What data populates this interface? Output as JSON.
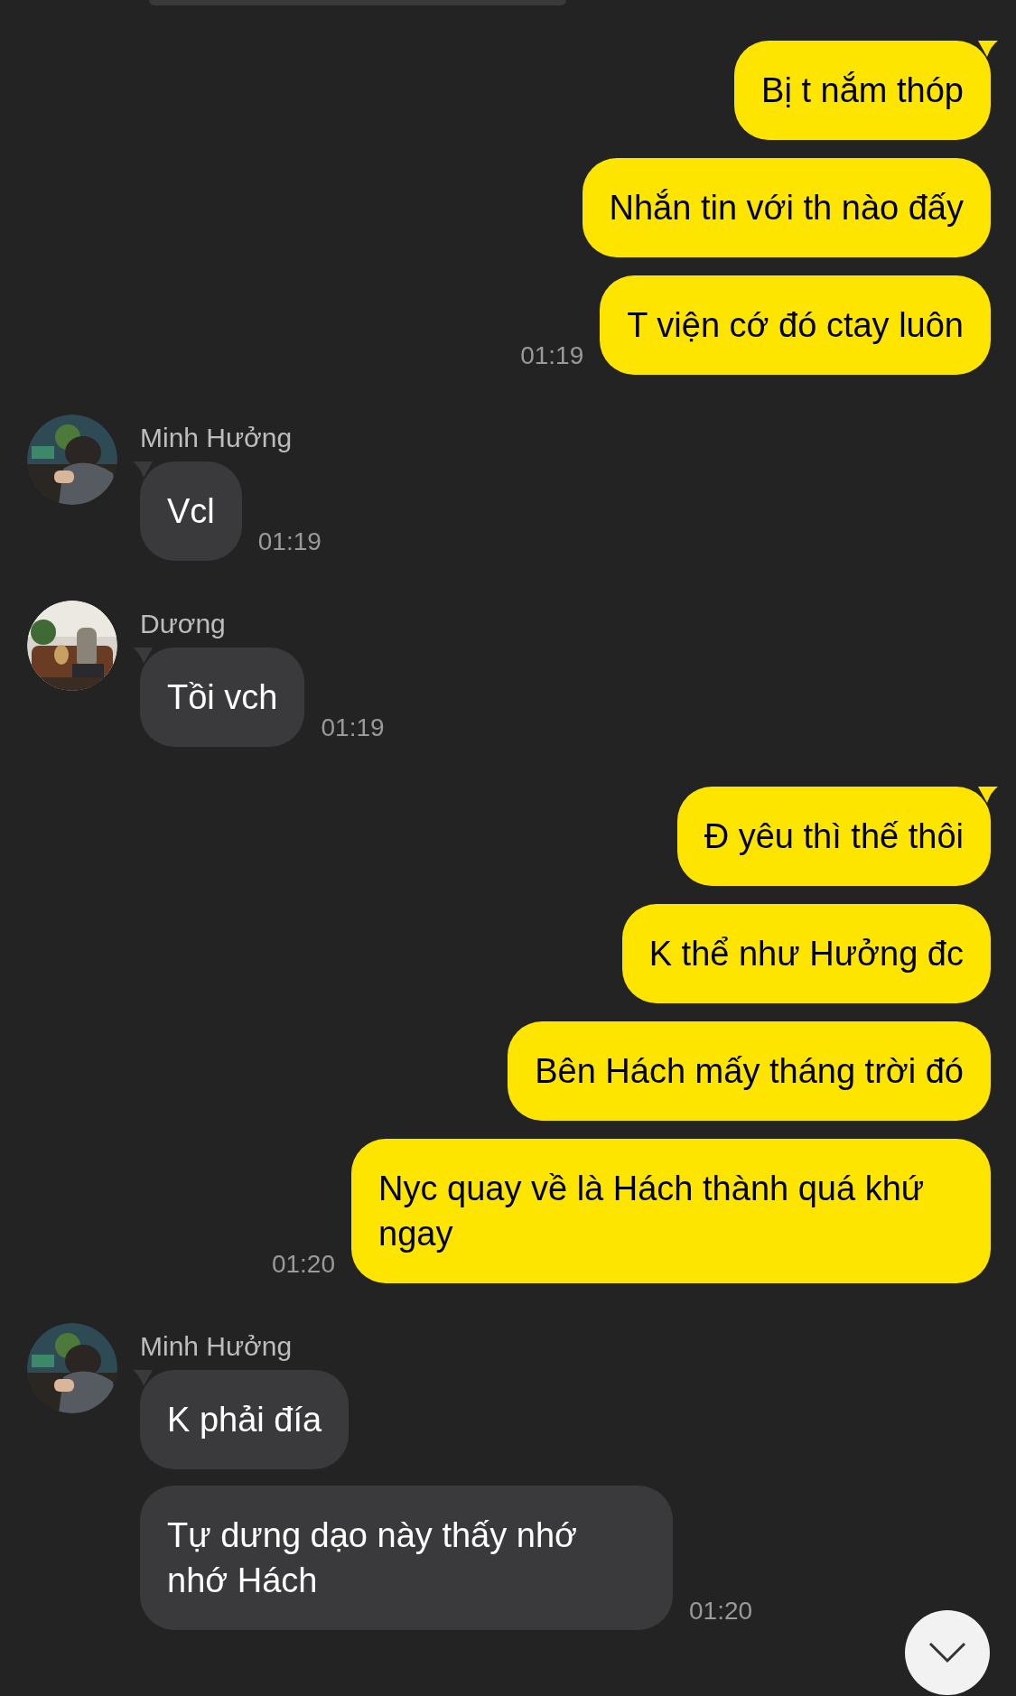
{
  "messages": [
    {
      "kind": "outgoing",
      "bubbles": [
        "Bị t nắm thóp",
        "Nhắn tin với th nào đấy",
        "T viện cớ đó ctay luôn"
      ],
      "time": "01:19"
    },
    {
      "kind": "incoming",
      "sender": "Minh Hưởng",
      "bubbles": [
        "Vcl"
      ],
      "time": "01:19"
    },
    {
      "kind": "incoming",
      "sender": "Dương",
      "bubbles": [
        "Tồi vch"
      ],
      "time": "01:19"
    },
    {
      "kind": "outgoing",
      "bubbles": [
        "Đ yêu thì thế thôi",
        "K thể như Hưởng đc",
        "Bên Hách mấy tháng trời đó",
        "Nyc quay về là Hách thành quá khứ ngay"
      ],
      "time": "01:20"
    },
    {
      "kind": "incoming",
      "sender": "Minh Hưởng",
      "bubbles": [
        "K phải đía",
        "Tự dưng dạo này thấy nhớ nhớ Hách"
      ],
      "time": "01:20"
    }
  ]
}
